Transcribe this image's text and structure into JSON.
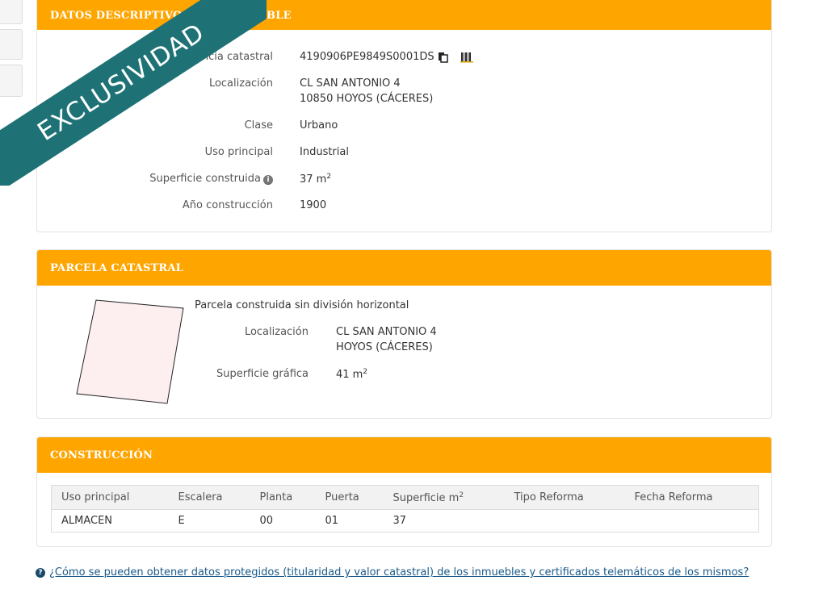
{
  "ribbon": {
    "text": "EXCLUSIVIDAD"
  },
  "descriptive": {
    "title": "DATOS DESCRIPTIVOS DEL INMUEBLE",
    "ref_label": "Referencia catastral",
    "ref_value": "4190906PE9849S0001DS",
    "loc_label": "Localización",
    "loc_line1": "CL SAN ANTONIO 4",
    "loc_line2": "10850 HOYOS (CÁCERES)",
    "clase_label": "Clase",
    "clase_value": "Urbano",
    "uso_label": "Uso principal",
    "uso_value": "Industrial",
    "sup_label": "Superficie construida",
    "sup_value": "37 m",
    "sup_unit_exp": "2",
    "anio_label": "Año construcción",
    "anio_value": "1900"
  },
  "parcela": {
    "title": "PARCELA CATASTRAL",
    "heading": "Parcela construida sin división horizontal",
    "loc_label": "Localización",
    "loc_line1": "CL SAN ANTONIO 4",
    "loc_line2": "HOYOS (CÁCERES)",
    "sup_label": "Superficie gráfica",
    "sup_value": "41 m",
    "sup_unit_exp": "2"
  },
  "construccion": {
    "title": "CONSTRUCCIÓN",
    "headers": [
      "Uso principal",
      "Escalera",
      "Planta",
      "Puerta",
      "Superficie m",
      "Tipo Reforma",
      "Fecha Reforma"
    ],
    "sup_header_exp": "2",
    "rows": [
      [
        "ALMACEN",
        "E",
        "00",
        "01",
        "37",
        "",
        ""
      ]
    ]
  },
  "footer": {
    "help_link": "¿Cómo se pueden obtener datos protegidos (titularidad y valor catastral) de los inmuebles y certificados telemáticos de los mismos?"
  },
  "colors": {
    "header": "#ffa500",
    "ribbon": "#1e7275",
    "link": "#1a5a8a"
  }
}
